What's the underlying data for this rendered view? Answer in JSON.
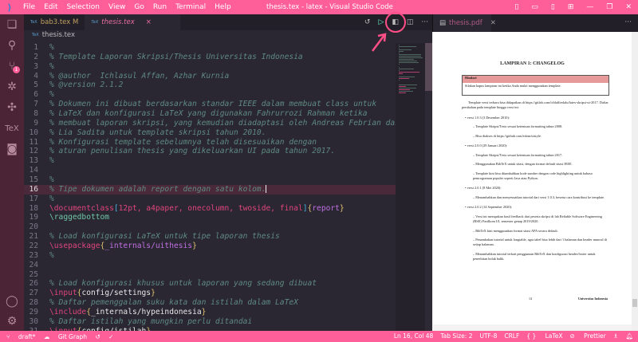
{
  "titlebar": {
    "menu": [
      "File",
      "Edit",
      "Selection",
      "View",
      "Go",
      "Run",
      "Terminal",
      "Help"
    ],
    "title": "thesis.tex - latex - Visual Studio Code"
  },
  "activity_bar": {
    "source_control_badge": "1"
  },
  "tabs": [
    {
      "label": "bab3.tex",
      "status": "M"
    },
    {
      "label": "thesis.tex",
      "close": "×"
    }
  ],
  "breadcrumb": "thesis.tex",
  "editor": {
    "current_line": 16,
    "lines": [
      [
        [
          "comment",
          "%"
        ]
      ],
      [
        [
          "comment",
          "% Template Laporan Skripsi/Thesis Universitas Indonesia"
        ]
      ],
      [
        [
          "comment",
          "%"
        ]
      ],
      [
        [
          "comment",
          "% @author  Ichlasul Affan, Azhar Kurnia"
        ]
      ],
      [
        [
          "comment",
          "% @version 2.1.2"
        ]
      ],
      [
        [
          "comment",
          "%"
        ]
      ],
      [
        [
          "comment",
          "% Dokumen ini dibuat berdasarkan standar IEEE dalam membuat class untuk"
        ]
      ],
      [
        [
          "comment",
          "% LaTeX dan konfigurasi LaTeX yang digunakan Fahrurrozi Rahman ketika"
        ]
      ],
      [
        [
          "comment",
          "% membuat laporan skripsi, yang kemudian diadaptasi oleh Andreas Febrian dan"
        ]
      ],
      [
        [
          "comment",
          "% Lia Sadita untuk template skripsi tahun 2010."
        ]
      ],
      [
        [
          "comment",
          "% Konfigurasi template sebelumnya telah disesuaikan dengan"
        ]
      ],
      [
        [
          "comment",
          "% aturan penulisan thesis yang dikeluarkan UI pada tahun 2017."
        ]
      ],
      [
        [
          "comment",
          "%"
        ]
      ],
      [],
      [
        [
          "comment",
          "%"
        ]
      ],
      [
        [
          "comment",
          "% Tipe dokumen adalah report dengan satu kolom."
        ]
      ],
      [
        [
          "comment",
          "%"
        ]
      ],
      [
        [
          "cmd",
          "\\documentclass"
        ],
        [
          "br",
          "["
        ],
        [
          "opt",
          "12pt, a4paper, onecolumn, twoside, final"
        ],
        [
          "br",
          "]"
        ],
        [
          "br2",
          "{"
        ],
        [
          "arg",
          "report"
        ],
        [
          "br2",
          "}"
        ]
      ],
      [
        [
          "cmd2",
          "\\raggedbottom"
        ]
      ],
      [],
      [
        [
          "comment",
          "% Load konfigurasi LaTeX untuk tipe laporan thesis"
        ]
      ],
      [
        [
          "cmd",
          "\\usepackage"
        ],
        [
          "br2",
          "{"
        ],
        [
          "arg",
          "_internals/uithesis"
        ],
        [
          "br2",
          "}"
        ]
      ],
      [
        [
          "comment",
          "%"
        ]
      ],
      [],
      [],
      [
        [
          "comment",
          "% Load konfigurasi khusus untuk laporan yang sedang dibuat"
        ]
      ],
      [
        [
          "cmd",
          "\\input"
        ],
        [
          "br2",
          "{"
        ],
        [
          "txt",
          "config/settings"
        ],
        [
          "br2",
          "}"
        ]
      ],
      [
        [
          "comment",
          "% Daftar pemenggalan suku kata dan istilah dalam LaTeX"
        ]
      ],
      [
        [
          "cmd",
          "\\include"
        ],
        [
          "br2",
          "{"
        ],
        [
          "txt",
          "_internals/hypeindonesia"
        ],
        [
          "br2",
          "}"
        ]
      ],
      [
        [
          "comment",
          "% Daftar istilah yang mungkin perlu ditandai"
        ]
      ],
      [
        [
          "cmd",
          "\\input"
        ],
        [
          "br2",
          "{"
        ],
        [
          "txt",
          "config/istilah"
        ],
        [
          "br2",
          "}"
        ]
      ]
    ]
  },
  "pdf": {
    "tab": "thesis.pdf",
    "title": "LAMPIRAN 1: CHANGELOG",
    "warning_title": "Hindari",
    "warning_body": "Silakan hapus lampiran ini ketika Anda mulai menggunakan template.",
    "intro": "Template versi terbaru bisa didapatkan di https://gitlab.com/ichlaffterlalu/latex-skripsi-ui-2017. Daftar perubahan pada template hingga versi ini:",
    "versions": [
      {
        "label": "versi 1.0.3 (3 Desember 2010):",
        "items": [
          "Template Skripsi/Tesis sesuai ketentuan formatting tahun 2008.",
          "Bisa diakses di https://github.com/edom/uistyle."
        ]
      },
      {
        "label": "versi 2.0.0 (29 Januari 2020):",
        "items": [
          "Template Skripsi/Tesis sesuai ketentuan formatting tahun 2017.",
          "Menggunakan BibTeX untuk sitasi, dengan format default sitasi IEEE.",
          "Template kini bisa ditambahkan kode sumber dengan code highlighting untuk bahasa pemrograman populer seperti Java atau Python."
        ]
      },
      {
        "label": "versi 2.0.1 (8 Mei 2020):",
        "items": [
          "Menambahkan dan menyesuaikan tutorial dari versi 1.0.3, beserta cara kontribusi ke template."
        ]
      },
      {
        "label": "versi 2.0.2 (14 September 2020):",
        "items": [
          "Versi ini merupakan hasil feedback dari peserta skripsi di lab Reliable Software Engineering (RSE) Fasilkom UI, semester genap 2019/2020.",
          "BibTeX kini menggunakan format sitasi APA secara default.",
          "Penambahan tutorial untuk longtable, agar tabel bisa lebih dari 1 halaman dan header muncul di setiap halaman.",
          "Menambahkan tutorial terkait penggunaan BibTeX dan konfigurasi header/footer untuk penerbitan bolak balik."
        ]
      }
    ],
    "page_number": "14",
    "footer_right": "Universitas Indonesia"
  },
  "statusbar": {
    "branch": "draft*",
    "git_graph": "Git Graph",
    "position": "Ln 16, Col 48",
    "tab_size": "Tab Size: 2",
    "encoding": "UTF-8",
    "eol": "CRLF",
    "language": "LaTeX",
    "prettier": "Prettier"
  },
  "colors": {
    "accent": "#ff5f98",
    "activity_bar": "#4b2536",
    "editor_bg": "#2a2733"
  }
}
